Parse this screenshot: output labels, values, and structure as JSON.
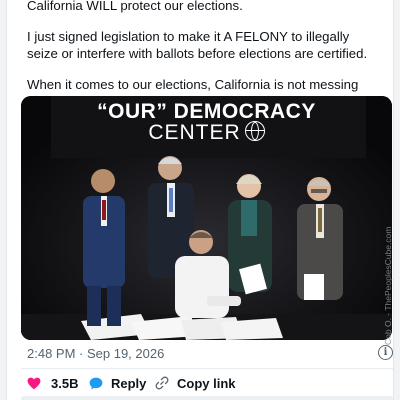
{
  "tweet": {
    "lines": [
      "California WILL protect our elections.",
      "I just signed legislation to make it A FELONY to illegally seize or interfere with ballots before elections are certified.",
      "When it comes to our elections, California is not messing around."
    ],
    "image": {
      "banner_line1": "“OUR” DEMOCRACY",
      "banner_line2": "CENTER"
    },
    "timestamp": "2:48 PM · Sep 19, 2026"
  },
  "actions": {
    "likes": "3.5B",
    "reply_label": "Reply",
    "copy_label": "Copy link"
  },
  "watermark": "Cob O. - ThePeoplesCube.com",
  "colors": {
    "heart": "#f91880",
    "reply": "#1d9bf0",
    "muted": "#536471"
  }
}
